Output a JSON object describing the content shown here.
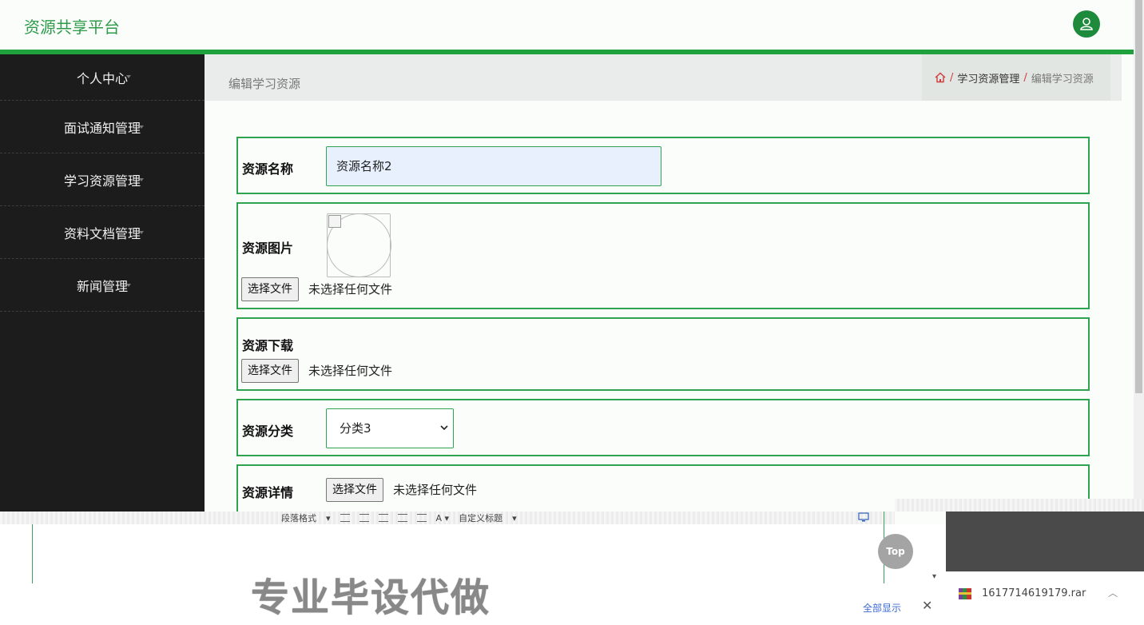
{
  "header": {
    "brand": "资源共享平台"
  },
  "sidebar": {
    "items": [
      {
        "label": "个人中心"
      },
      {
        "label": "面试通知管理"
      },
      {
        "label": "学习资源管理"
      },
      {
        "label": "资料文档管理"
      },
      {
        "label": "新闻管理"
      }
    ]
  },
  "page": {
    "title": "编辑学习资源",
    "breadcrumb": {
      "sep": "/",
      "parent": "学习资源管理",
      "current": "编辑学习资源"
    }
  },
  "form": {
    "name": {
      "label": "资源名称",
      "value": "资源名称2"
    },
    "image": {
      "label": "资源图片",
      "button": "选择文件",
      "status": "未选择任何文件"
    },
    "download": {
      "label": "资源下载",
      "button": "选择文件",
      "status": "未选择任何文件"
    },
    "category": {
      "label": "资源分类",
      "value": "分类3"
    },
    "detail": {
      "label": "资源详情",
      "button": "选择文件",
      "status": "未选择任何文件"
    }
  },
  "editor": {
    "format_label": "段落格式",
    "custom_title": "自定义标题",
    "watermark": "专业毕设代做"
  },
  "overlay": {
    "top_button": "Top",
    "download_file": "1617714619179.rar",
    "show_all": "全部显示",
    "close": "✕"
  },
  "colors": {
    "accent": "#1fa23e",
    "sidebar": "#1b1c1b",
    "avatar": "#1e8a3c"
  }
}
